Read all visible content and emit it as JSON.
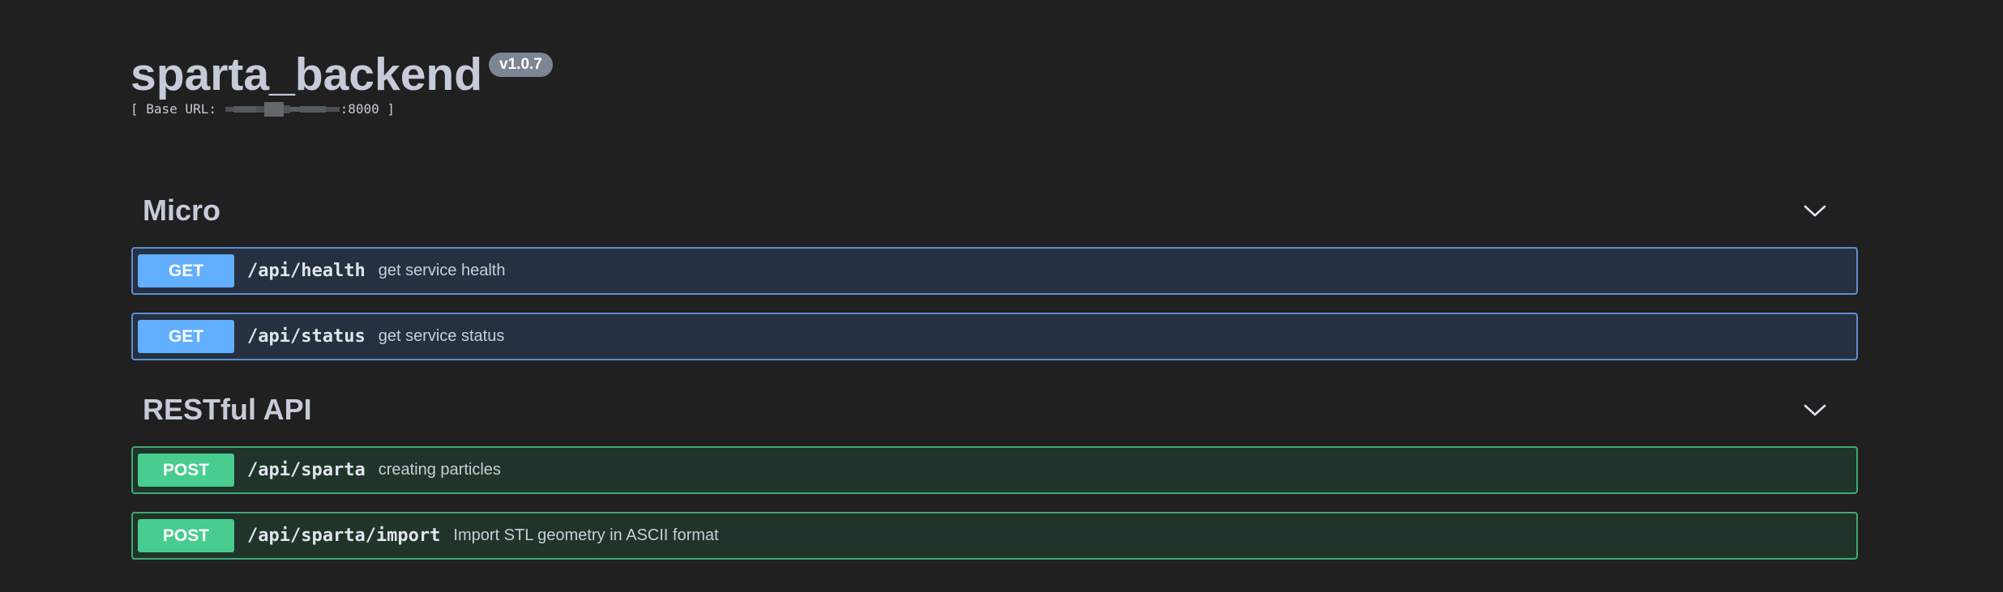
{
  "header": {
    "title": "sparta_backend",
    "version": "v1.0.7",
    "base_url_prefix": "[ Base URL: ",
    "base_url_port": ":8000 ]"
  },
  "sections": [
    {
      "title": "Micro",
      "operations": [
        {
          "method": "GET",
          "path": "/api/health",
          "summary": "get service health"
        },
        {
          "method": "GET",
          "path": "/api/status",
          "summary": "get service status"
        }
      ]
    },
    {
      "title": "RESTful API",
      "operations": [
        {
          "method": "POST",
          "path": "/api/sparta",
          "summary": "creating particles"
        },
        {
          "method": "POST",
          "path": "/api/sparta/import",
          "summary": "Import STL geometry in ASCII format"
        }
      ]
    }
  ],
  "icons": {
    "section_toggle": "chevron-down-icon"
  },
  "colors": {
    "background": "#202020",
    "get_method": "#61affe",
    "post_method": "#49cc90",
    "get_border": "#5c8fd0",
    "post_border": "#3fa874",
    "version_badge": "#7d8492"
  }
}
